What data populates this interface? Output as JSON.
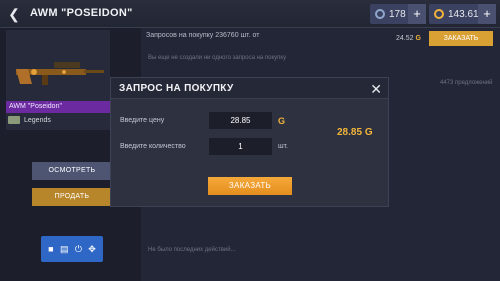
{
  "header": {
    "back_icon": "back-arrow-icon",
    "title": "AWM \"POSEIDON\"",
    "silver_balance": "178",
    "gold_balance": "143.61",
    "plus_label": "+"
  },
  "item": {
    "name": "AWM \"Poseidon\"",
    "rarity": "Legends",
    "inspect_label": "ОСМОТРЕТЬ",
    "sell_label": "ПРОДАТЬ"
  },
  "market": {
    "requests_text": "Запросов на покупку 236760 шт. от",
    "requests_price": "24.52",
    "order_label": "ЗАКАЗАТЬ",
    "no_request_text": "Вы еще не создали ни одного запроса на покупку",
    "offers_text": "4473 предложений",
    "history_text": "Не было последних действий..."
  },
  "dialog": {
    "title": "ЗАПРОС НА ПОКУПКУ",
    "price_label": "Введите цену",
    "price_value": "28.85",
    "quantity_label": "Введите количество",
    "quantity_value": "1",
    "unit": "шт.",
    "total": "28.85",
    "order_label": "ЗАКАЗАТЬ"
  },
  "colors": {
    "accent_gold": "#f2b53a",
    "order_orange": "#e48e1e",
    "legend_purple": "#6b2aa0",
    "toolbar_blue": "#2f67c6"
  }
}
